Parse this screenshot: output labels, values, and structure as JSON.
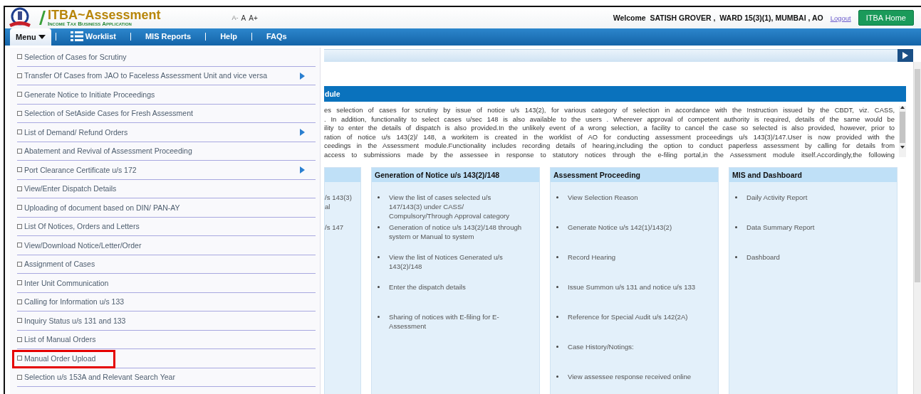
{
  "header": {
    "logo_title": "ITBA~Assessment",
    "logo_subtitle": "Income Tax Business Application",
    "font_sizes": [
      "A-",
      "A",
      "A+"
    ],
    "welcome": "Welcome  SATISH GROVER ,  WARD 15(3)(1), MUMBAI , AO",
    "logout": "Logout",
    "home_button": "ITBA Home"
  },
  "nav": [
    {
      "label": "Menu",
      "kind": "dropdown",
      "selected": true
    },
    {
      "label": "Worklist",
      "kind": "list",
      "selected": false
    },
    {
      "label": "MIS Reports",
      "kind": "plain",
      "selected": false
    },
    {
      "label": "Help",
      "kind": "plain",
      "selected": false
    },
    {
      "label": "FAQs",
      "kind": "plain",
      "selected": false
    }
  ],
  "menu": [
    {
      "label": "Selection of Cases for Scrutiny",
      "submenu": false,
      "highlighted": false
    },
    {
      "label": "Transfer Of Cases from JAO to Faceless Assessment Unit and vice versa",
      "submenu": true,
      "highlighted": false
    },
    {
      "label": "Generate Notice to Initiate Proceedings",
      "submenu": false,
      "highlighted": false
    },
    {
      "label": "Selection of SetAside Cases for Fresh Assessment",
      "submenu": false,
      "highlighted": false
    },
    {
      "label": "List of Demand/ Refund Orders",
      "submenu": true,
      "highlighted": false
    },
    {
      "label": "Abatement and Revival of Assessment Proceeding",
      "submenu": false,
      "highlighted": false
    },
    {
      "label": "Port Clearance Certificate u/s 172",
      "submenu": true,
      "highlighted": false
    },
    {
      "label": "View/Enter Dispatch Details",
      "submenu": false,
      "highlighted": false
    },
    {
      "label": "Uploading of document based on DIN/ PAN-AY",
      "submenu": false,
      "highlighted": false
    },
    {
      "label": "List Of Notices, Orders and Letters",
      "submenu": false,
      "highlighted": false
    },
    {
      "label": "View/Download Notice/Letter/Order",
      "submenu": false,
      "highlighted": false
    },
    {
      "label": "Assignment of Cases",
      "submenu": false,
      "highlighted": false
    },
    {
      "label": "Inter Unit Communication",
      "submenu": false,
      "highlighted": false
    },
    {
      "label": "Calling for Information u/s 133",
      "submenu": false,
      "highlighted": false
    },
    {
      "label": "Inquiry Status u/s 131 and 133",
      "submenu": false,
      "highlighted": false
    },
    {
      "label": "List of Manual Orders",
      "submenu": false,
      "highlighted": false
    },
    {
      "label": "Manual Order Upload",
      "submenu": false,
      "highlighted": true
    },
    {
      "label": "Selection u/s 153A and Relevant Search Year",
      "submenu": false,
      "highlighted": false
    }
  ],
  "section": {
    "title": "dule",
    "description_lines": [
      "es selection of cases for scrutiny by issue of notice u/s 143(2), for various category of selection in accordance with the Instruction issued by the CBDT, viz. CASS,",
      ". In addition, functionality to select cases u/sec 148 is also available to the users . Wherever approval of competent authority is required, details of the same would be",
      "ility to enter the details of dispatch is also provided.In the unlikely event of a wrong selection, a facility to cancel the case so selected is also provided, however, prior to",
      "ration of notice u/s 143(2)/ 148, a workitem is created in the worklist of AO for conducting assessment proceedings u/s 143(3)/147.User is now provided with the",
      "ceedings in the Assessment module.Functionality includes recording details of hearing,including the option to conduct paperless assessment by calling for details from",
      "access to submissions made by the assessee in response to statutory notices through the e-filing portal,in the Assessment module itself.Accordingly,the following"
    ]
  },
  "columns": [
    {
      "items": [
        {
          "lines": [
            "/s 143(3)",
            "al"
          ],
          "bullet": false
        },
        {
          "lines": [
            "/s 147"
          ],
          "bullet": false
        }
      ]
    },
    {
      "title": "Generation of Notice u/s 143(2)/148",
      "items": [
        {
          "lines": [
            "View the list of cases selected u/s",
            "147/143(3) under CASS/",
            "Compulsory/Through Approval category"
          ],
          "bullet": true
        },
        {
          "lines": [
            "Generation of notice u/s 143(2)/148 through",
            "system or Manual to system"
          ],
          "bullet": true
        },
        {
          "lines": [
            "View the list of Notices Generated u/s",
            "143(2)/148"
          ],
          "bullet": true
        },
        {
          "lines": [
            "Enter the dispatch details"
          ],
          "bullet": true
        },
        {
          "lines": [
            "Sharing of notices with E-filing for E-",
            "Assessment"
          ],
          "bullet": true
        }
      ]
    },
    {
      "title": "Assessment Proceeding",
      "items": [
        {
          "lines": [
            "View Selection Reason"
          ],
          "bullet": true
        },
        {
          "lines": [
            "Generate Notice u/s 142(1)/143(2)"
          ],
          "bullet": true
        },
        {
          "lines": [
            "Record Hearing"
          ],
          "bullet": true
        },
        {
          "lines": [
            "Issue Summon u/s 131 and notice u/s 133"
          ],
          "bullet": true
        },
        {
          "lines": [
            "Reference for Special Audit u/s 142(2A)"
          ],
          "bullet": true
        },
        {
          "lines": [
            "Case History/Notings:"
          ],
          "bullet": true
        },
        {
          "lines": [
            "View assessee response received online"
          ],
          "bullet": true
        }
      ]
    },
    {
      "title": "MIS and Dashboard",
      "items": [
        {
          "lines": [
            "Daily Activity Report"
          ],
          "bullet": true
        },
        {
          "lines": [
            "Data Summary Report"
          ],
          "bullet": true
        },
        {
          "lines": [
            "Dashboard"
          ],
          "bullet": true
        }
      ]
    }
  ]
}
